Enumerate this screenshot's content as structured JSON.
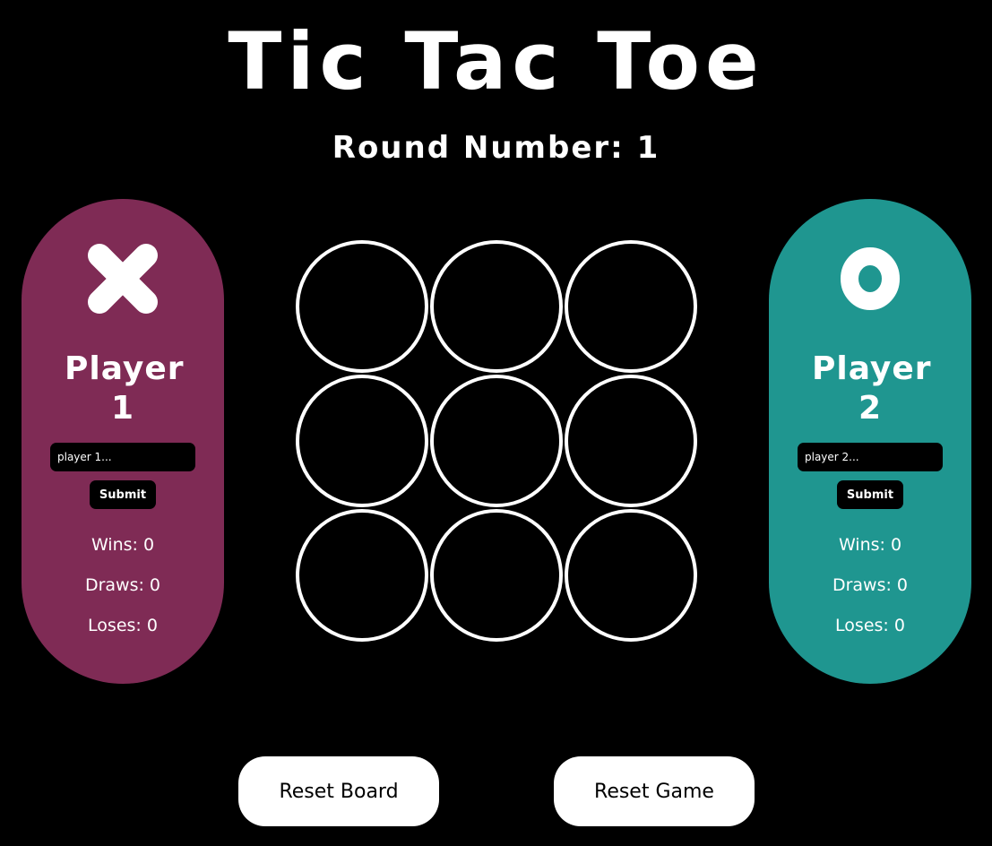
{
  "title": "Tic Tac Toe",
  "round": "Round Number: 1",
  "players": [
    {
      "symbol_icon": "x-mark-icon",
      "name": "Player 1",
      "placeholder": "player 1...",
      "submit_label": "Submit",
      "wins": "Wins: 0",
      "draws": "Draws: 0",
      "loses": "Loses: 0",
      "color": "#7f2b55"
    },
    {
      "symbol_icon": "o-mark-icon",
      "name": "Player 2",
      "placeholder": "player 2...",
      "submit_label": "Submit",
      "wins": "Wins: 0",
      "draws": "Draws: 0",
      "loses": "Loses: 0",
      "color": "#1f9690"
    }
  ],
  "board": {
    "cells": [
      "",
      "",
      "",
      "",
      "",
      "",
      "",
      "",
      ""
    ]
  },
  "buttons": {
    "reset_board": "Reset Board",
    "reset_game": "Reset Game"
  },
  "colors": {
    "background": "#000000",
    "text": "#ffffff"
  }
}
